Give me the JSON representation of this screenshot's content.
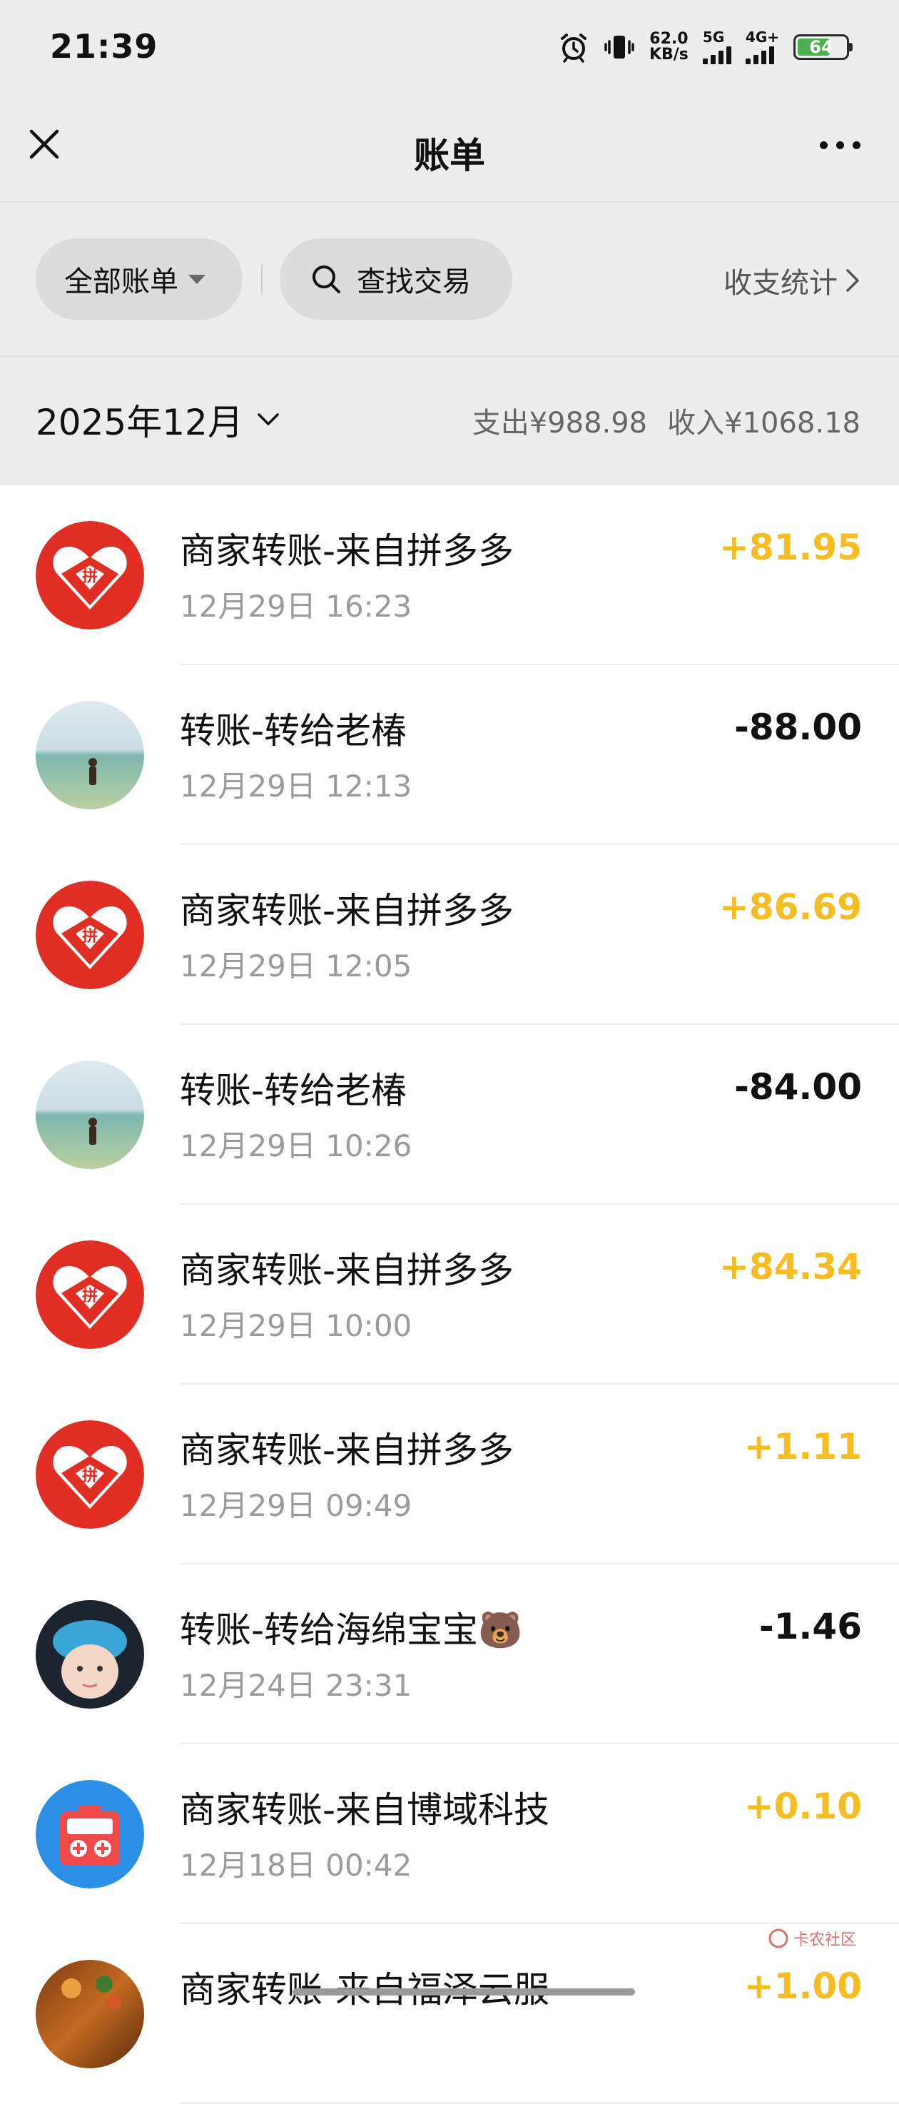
{
  "status_bar": {
    "time": "21:39",
    "net_speed_value": "62.0",
    "net_speed_unit": "KB/s",
    "sim1_label": "5G",
    "sim2_label": "4G+",
    "battery_level": "64"
  },
  "header": {
    "title": "账单"
  },
  "filters": {
    "all_bills_label": "全部账单",
    "search_label": "查找交易",
    "stats_label": "收支统计"
  },
  "month": {
    "label": "2025年12月",
    "expense_summary": "支出¥988.98",
    "income_summary": "收入¥1068.18"
  },
  "transactions": [
    {
      "title": "商家转账-来自拼多多",
      "time": "12月29日 16:23",
      "amount": "+81.95",
      "avatar": "pinduoduo-logo"
    },
    {
      "title": "转账-转给老椿",
      "time": "12月29日 12:13",
      "amount": "-88.00",
      "avatar": "beach-photo"
    },
    {
      "title": "商家转账-来自拼多多",
      "time": "12月29日 12:05",
      "amount": "+86.69",
      "avatar": "pinduoduo-logo"
    },
    {
      "title": "转账-转给老椿",
      "time": "12月29日 10:26",
      "amount": "-84.00",
      "avatar": "beach-photo"
    },
    {
      "title": "商家转账-来自拼多多",
      "time": "12月29日 10:00",
      "amount": "+84.34",
      "avatar": "pinduoduo-logo"
    },
    {
      "title": "商家转账-来自拼多多",
      "time": "12月29日 09:49",
      "amount": "+1.11",
      "avatar": "pinduoduo-logo"
    },
    {
      "title": "转账-转给海绵宝宝🐻",
      "time": "12月24日 23:31",
      "amount": "-1.46",
      "avatar": "child-photo"
    },
    {
      "title": "商家转账-来自博域科技",
      "time": "12月18日 00:42",
      "amount": "+0.10",
      "avatar": "game-console-logo"
    },
    {
      "title": "商家转账-来自福泽云服",
      "time": "",
      "amount": "+1.00",
      "avatar": "food-photo"
    }
  ],
  "watermark": {
    "text": "卡农社区"
  },
  "colors": {
    "income": "#f5bd1f",
    "expense": "#111111",
    "header_bg": "#ededed",
    "pill_bg": "#dcdcdc",
    "pinduoduo_red": "#e02e24"
  }
}
